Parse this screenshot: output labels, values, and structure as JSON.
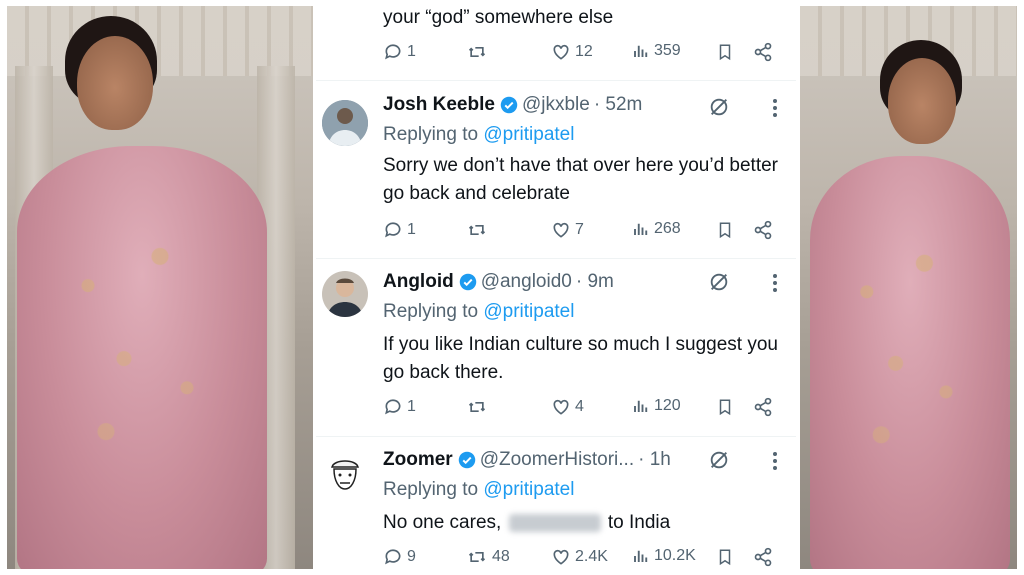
{
  "top_fragment": {
    "text": "your “god” somewhere else"
  },
  "top_actions": {
    "replies": "1",
    "reposts": "",
    "likes": "12",
    "views": "359"
  },
  "tweets": [
    {
      "name": "Josh Keeble",
      "handle": "@jkxble",
      "time": "· 52m",
      "replying_prefix": "Replying to",
      "replying_to": "@pritipatel",
      "text": "Sorry we don’t have that over here you’d better go back and celebrate",
      "replies": "1",
      "reposts": "",
      "likes": "7",
      "views": "268"
    },
    {
      "name": "Angloid",
      "handle": "@angloid0",
      "time": "· 9m",
      "replying_prefix": "Replying to",
      "replying_to": "@pritipatel",
      "text": "If you like Indian culture so much I suggest you go back there.",
      "replies": "1",
      "reposts": "",
      "likes": "4",
      "views": "120"
    },
    {
      "name": "Zoomer",
      "handle": "@ZoomerHistori...",
      "time": "· 1h",
      "replying_prefix": "Replying to",
      "replying_to": "@pritipatel",
      "text_before": "No one cares,",
      "text_after": "to India",
      "replies": "9",
      "reposts": "48",
      "likes": "2.4K",
      "views": "10.2K"
    }
  ],
  "colors": {
    "verified": "#1d9bf0",
    "link": "#1d9bf0",
    "muted": "#536471",
    "text": "#0f1419"
  },
  "icons": [
    "reply-icon",
    "repost-icon",
    "like-icon",
    "views-icon",
    "bookmark-icon",
    "share-icon",
    "grok-icon",
    "more-icon",
    "verified-badge-icon"
  ]
}
